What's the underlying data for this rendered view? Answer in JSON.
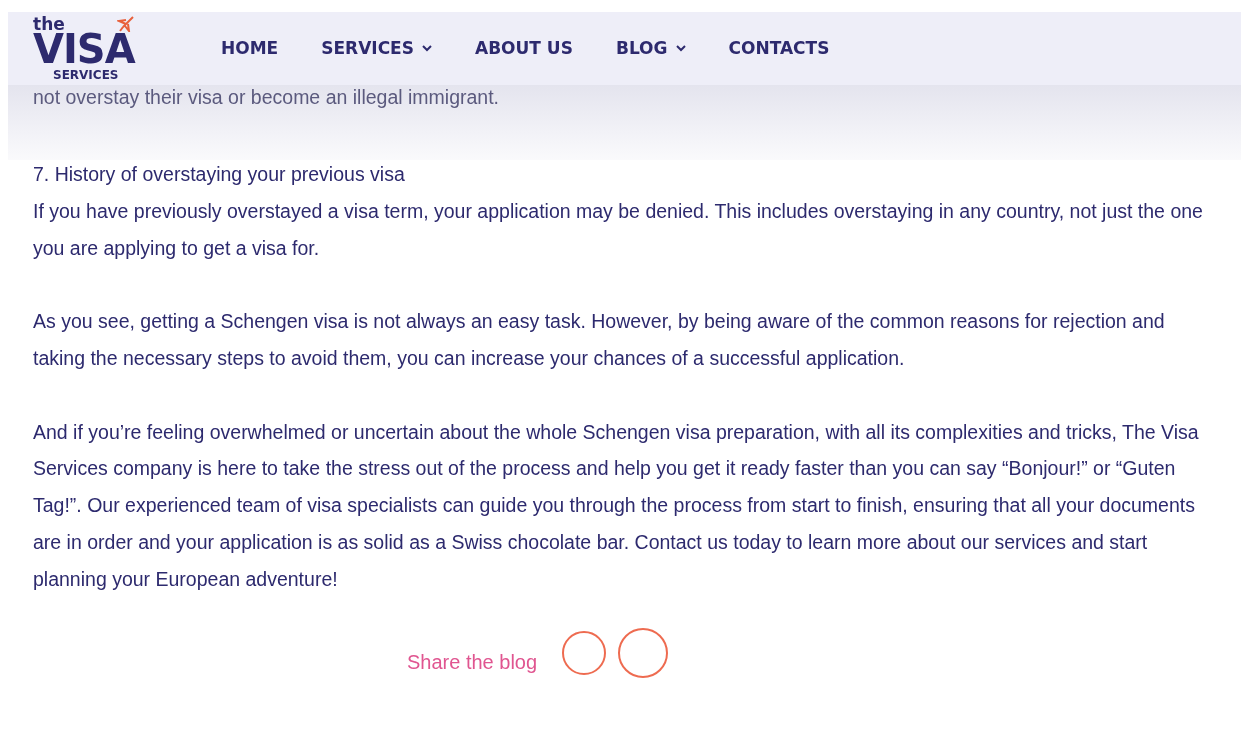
{
  "logo": {
    "line_1": "the",
    "line_2": "VISA",
    "line_3": "SERVICES"
  },
  "nav": [
    {
      "label": "HOME",
      "dropdown": false
    },
    {
      "label": "SERVICES",
      "dropdown": true
    },
    {
      "label": "ABOUT US",
      "dropdown": false
    },
    {
      "label": "BLOG",
      "dropdown": true
    },
    {
      "label": "CONTACTS",
      "dropdown": false
    }
  ],
  "faded_line": "not overstay their visa or become an illegal immigrant.",
  "section_heading": "7. History of overstaying your previous visa",
  "paragraphs": [
    "If you have previously overstayed a visa term, your application may be denied. This includes overstaying in any country, not just the one you are applying to get a visa for.",
    "As you see, getting a Schengen visa is not always an easy task. However, by being aware of the common reasons for rejection and taking the necessary steps to avoid them, you can increase your chances of a successful application.",
    "And if you’re feeling overwhelmed or uncertain about the whole Schengen visa preparation, with all its complexities and tricks, The Visa Services company is here to take the stress out of the process and help you get it ready faster than you can say “Bonjour!” or “Guten Tag!”. Our experienced team of visa specialists can guide you through the process from start to finish, ensuring that all your documents are in order and your application is as solid as a Swiss chocolate bar. Contact us today to learn more about our services and start planning your European adventure!"
  ],
  "share": {
    "label": "Share the blog"
  }
}
